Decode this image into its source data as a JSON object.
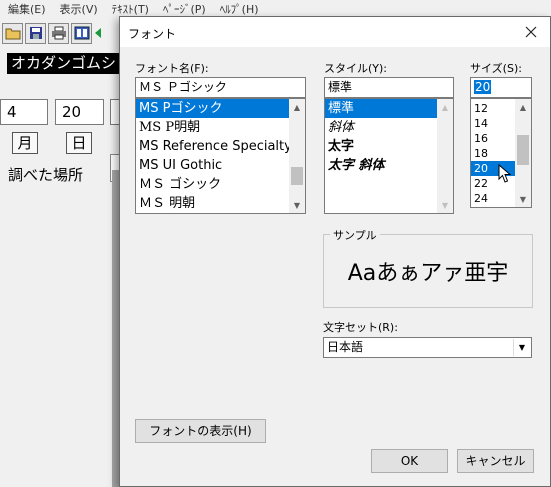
{
  "menubar": {
    "items": [
      "編集(E)",
      "表示(V)",
      "ﾃｷｽﾄ(T)",
      "ﾍﾟｰｼﾞ(P)",
      "ﾍﾙﾌﾟ(H)"
    ]
  },
  "app": {
    "katakana": "オカダンゴムシ",
    "month_value": "4",
    "day_value": "20",
    "month_label": "月",
    "day_label": "日",
    "place_label": "調べた場所"
  },
  "dialog": {
    "title": "フォント",
    "font_name": {
      "label": "フォント名(F):",
      "value": "ＭＳ Ｐゴシック",
      "items": [
        "MS Pゴシック",
        "MS P明朝",
        "MS Reference Specialty",
        "MS UI Gothic",
        "ＭＳ ゴシック",
        "ＭＳ 明朝"
      ],
      "selected": "MS Pゴシック"
    },
    "style": {
      "label": "スタイル(Y):",
      "value": "標準",
      "items": [
        "標準",
        "斜体",
        "太字",
        "太字 斜体"
      ],
      "selected": "標準"
    },
    "size": {
      "label": "サイズ(S):",
      "value": "20",
      "items": [
        "12",
        "14",
        "16",
        "18",
        "20",
        "22",
        "24"
      ],
      "selected": "20"
    },
    "sample": {
      "legend": "サンプル",
      "text": "Aaあぁアァ亜宇"
    },
    "charset": {
      "label": "文字セット(R):",
      "value": "日本語"
    },
    "buttons": {
      "show_fonts": "フォントの表示(H)",
      "ok": "OK",
      "cancel": "キャンセル"
    }
  },
  "colors": {
    "selection": "#0078d7",
    "dialog_bg": "#f0f0f0"
  }
}
